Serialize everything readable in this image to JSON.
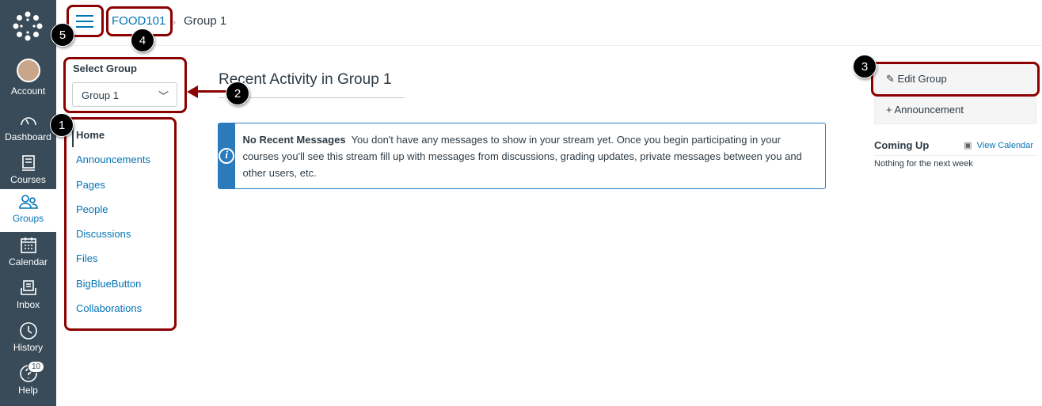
{
  "global_nav": {
    "items": [
      {
        "label": "Account",
        "icon": "avatar"
      },
      {
        "label": "Dashboard",
        "icon": "dashboard-icon"
      },
      {
        "label": "Courses",
        "icon": "courses-icon"
      },
      {
        "label": "Groups",
        "icon": "groups-icon",
        "active": true
      },
      {
        "label": "Calendar",
        "icon": "calendar-icon"
      },
      {
        "label": "Inbox",
        "icon": "inbox-icon"
      },
      {
        "label": "History",
        "icon": "history-icon"
      },
      {
        "label": "Help",
        "icon": "help-icon",
        "badge": "10"
      }
    ]
  },
  "breadcrumb": {
    "course": "FOOD101",
    "group": "Group 1"
  },
  "select_group": {
    "label": "Select Group",
    "value": "Group 1"
  },
  "course_nav": [
    "Home",
    "Announcements",
    "Pages",
    "People",
    "Discussions",
    "Files",
    "BigBlueButton",
    "Collaborations"
  ],
  "main": {
    "title": "Recent Activity in Group 1",
    "info_title": "No Recent Messages",
    "info_text": "You don't have any messages to show in your stream yet. Once you begin participating in your courses you'll see this stream fill up with messages from discussions, grading updates, private messages between you and other users, etc."
  },
  "sidebar": {
    "edit_group": "Edit Group",
    "announcement": "Announcement",
    "coming_up": "Coming Up",
    "view_calendar": "View Calendar",
    "nothing": "Nothing for the next week"
  },
  "annotations": [
    "1",
    "2",
    "3",
    "4",
    "5"
  ],
  "colors": {
    "nav": "#394b58",
    "link": "#0374b5",
    "annotation": "#8b0000"
  }
}
